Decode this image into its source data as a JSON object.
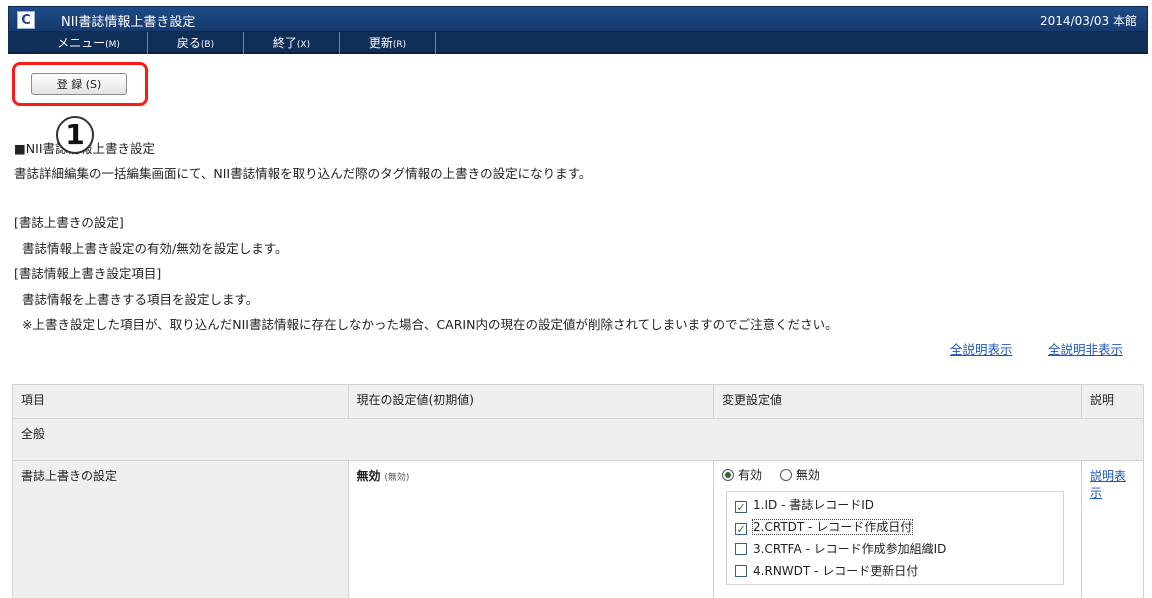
{
  "window": {
    "icon": "C",
    "title": "NII書誌情報上書き設定",
    "date_branch": "2014/03/03 本館"
  },
  "menu": {
    "items": [
      {
        "label": "メニュー",
        "shortcut": "(M)"
      },
      {
        "label": "戻る",
        "shortcut": "(B)"
      },
      {
        "label": "終了",
        "shortcut": "(X)"
      },
      {
        "label": "更新",
        "shortcut": "(R)"
      }
    ]
  },
  "toolbar": {
    "register_label": "登 録 (S)",
    "callout_number": "1"
  },
  "intro": {
    "heading": "■NII書誌情報上書き設定",
    "description": "書誌詳細編集の一括編集画面にて、NII書誌情報を取り込んだ際のタグ情報の上書きの設定になります。",
    "section1_title": "[書誌上書きの設定]",
    "section1_desc": "書誌情報上書き設定の有効/無効を設定します。",
    "section2_title": "[書誌情報上書き設定項目]",
    "section2_desc": "書誌情報を上書きする項目を設定します。",
    "section2_note": "※上書き設定した項目が、取り込んだNII書誌情報に存在しなかった場合、CARIN内の現在の設定値が削除されてしまいますのでご注意ください。"
  },
  "links": {
    "show_all": "全説明表示",
    "hide_all": "全説明非表示"
  },
  "table": {
    "headers": {
      "item": "項目",
      "current": "現在の設定値(初期値)",
      "change": "変更設定値",
      "desc": "説明"
    },
    "section": "全般",
    "row": {
      "label": "書誌上書きの設定",
      "current_value": "無効",
      "current_initial": "(無効)",
      "radio_enabled": "有効",
      "radio_disabled": "無効",
      "selected": "有効",
      "desc_link": "説明表示",
      "checkboxes": [
        {
          "label": "1.ID - 書誌レコードID",
          "checked": true
        },
        {
          "label": "2.CRTDT - レコード作成日付",
          "checked": true
        },
        {
          "label": "3.CRTFA - レコード作成参加組織ID",
          "checked": false
        },
        {
          "label": "4.RNWDT - レコード更新日付",
          "checked": false
        }
      ]
    }
  }
}
